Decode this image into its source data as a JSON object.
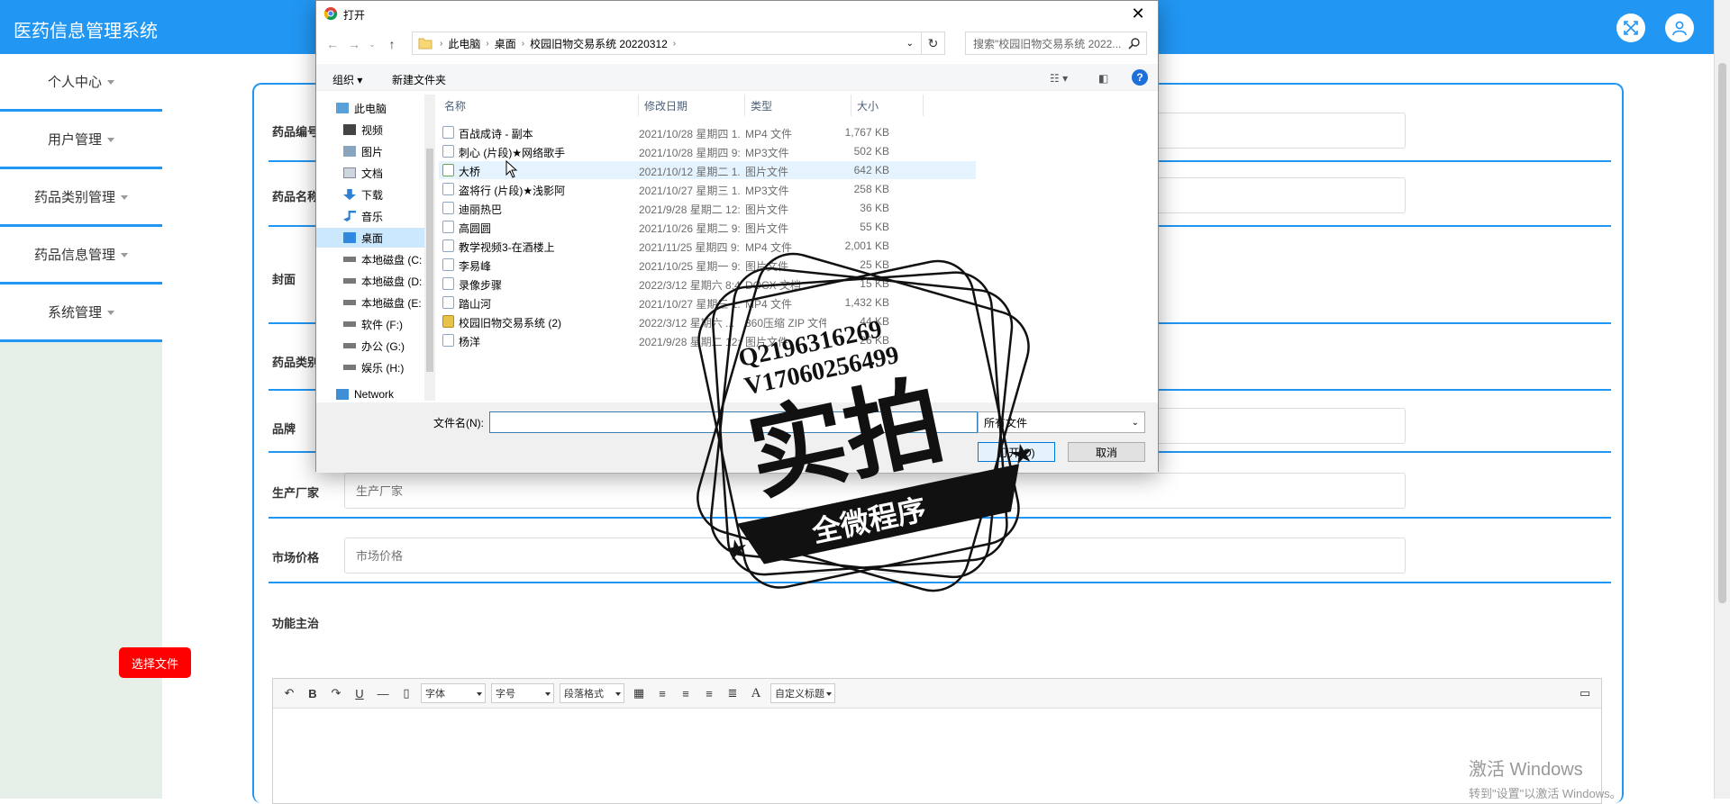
{
  "app": {
    "title": "医药信息管理系统"
  },
  "header": {
    "fullscreen_icon": "fullscreen-icon",
    "user_icon": "user-icon",
    "color": "#2196f3"
  },
  "sidebar": {
    "items": [
      {
        "label": "个人中心"
      },
      {
        "label": "用户管理"
      },
      {
        "label": "药品类别管理"
      },
      {
        "label": "药品信息管理"
      },
      {
        "label": "系统管理"
      }
    ]
  },
  "form": {
    "fields": [
      {
        "label": "药品编号"
      },
      {
        "label": "药品名称"
      },
      {
        "label": "封面"
      },
      {
        "label": "药品类别"
      },
      {
        "label": "品牌"
      },
      {
        "label": "生产厂家",
        "placeholder": "生产厂家"
      },
      {
        "label": "市场价格",
        "placeholder": "市场价格"
      },
      {
        "label": "功能主治"
      }
    ],
    "upload_button": "选择文件",
    "editor": {
      "font": "字体",
      "size": "字号",
      "paragraph": "段落格式",
      "custom_title": "自定义标题",
      "bold": "B",
      "underline": "U",
      "font_color": "A"
    }
  },
  "dialog": {
    "title": "打开",
    "path": [
      "此电脑",
      "桌面",
      "校园旧物交易系统 20220312"
    ],
    "search_placeholder": "搜索\"校园旧物交易系统 2022...",
    "organize": "组织 ▾",
    "new_folder": "新建文件夹",
    "nav": [
      {
        "label": "此电脑"
      },
      {
        "label": "视频"
      },
      {
        "label": "图片"
      },
      {
        "label": "文档"
      },
      {
        "label": "下载"
      },
      {
        "label": "音乐"
      },
      {
        "label": "桌面"
      },
      {
        "label": "本地磁盘 (C:"
      },
      {
        "label": "本地磁盘 (D:"
      },
      {
        "label": "本地磁盘 (E:"
      },
      {
        "label": "软件 (F:)"
      },
      {
        "label": "办公 (G:)"
      },
      {
        "label": "娱乐 (H:)"
      },
      {
        "label": "Network"
      }
    ],
    "columns": {
      "name": "名称",
      "date": "修改日期",
      "type": "类型",
      "size": "大小"
    },
    "files": [
      {
        "name": "百战成诗 - 副本",
        "date": "2021/10/28 星期四 1...",
        "type": "MP4 文件",
        "size": "1,767 KB"
      },
      {
        "name": "刺心 (片段)★网络歌手",
        "date": "2021/10/28 星期四 9:...",
        "type": "MP3文件",
        "size": "502 KB"
      },
      {
        "name": "大桥",
        "date": "2021/10/12 星期二 1...",
        "type": "图片文件",
        "size": "642 KB"
      },
      {
        "name": "盗将行 (片段)★浅影阿",
        "date": "2021/10/27 星期三 1...",
        "type": "MP3文件",
        "size": "258 KB"
      },
      {
        "name": "迪丽热巴",
        "date": "2021/9/28 星期二 12:...",
        "type": "图片文件",
        "size": "36 KB"
      },
      {
        "name": "高圆圆",
        "date": "2021/10/26 星期二 9:...",
        "type": "图片文件",
        "size": "55 KB"
      },
      {
        "name": "教学视频3-在酒楼上",
        "date": "2021/11/25 星期四 9:...",
        "type": "MP4 文件",
        "size": "2,001 KB"
      },
      {
        "name": "李易峰",
        "date": "2021/10/25 星期一 9:...",
        "type": "图片文件",
        "size": "25 KB"
      },
      {
        "name": "录像步骤",
        "date": "2022/3/12 星期六 8:43",
        "type": "DOCX 文档",
        "size": "15 KB"
      },
      {
        "name": "踏山河",
        "date": "2021/10/27 星期三 1...",
        "type": "MP4 文件",
        "size": "1,432 KB"
      },
      {
        "name": "校园旧物交易系统 (2)",
        "date": "2022/3/12 星期六 ...",
        "type": "360压缩 ZIP 文件",
        "size": "44 KB"
      },
      {
        "name": "杨洋",
        "date": "2021/9/28 星期二 12:...",
        "type": "图片文件",
        "size": "26 KB"
      }
    ],
    "filename_label": "文件名(N):",
    "filetype": "所有文件",
    "open_button": "打开(O)",
    "cancel_button": "取消"
  },
  "watermark": {
    "line1": "Q2196316269",
    "line2": "V17060256499",
    "big": "实拍",
    "banner": "全微程序"
  },
  "windows_activation": {
    "line1": "激活 Windows",
    "line2": "转到\"设置\"以激活 Windows。"
  }
}
